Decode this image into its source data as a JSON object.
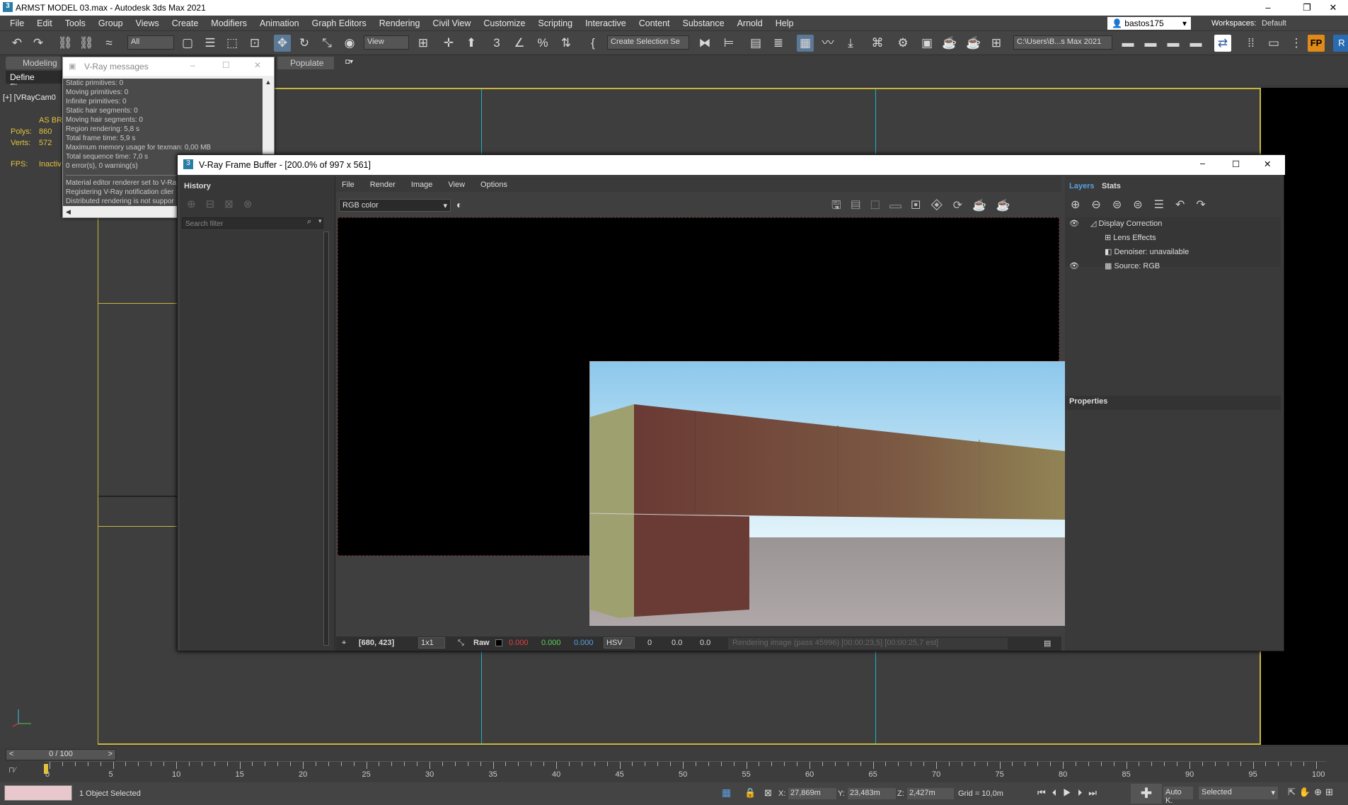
{
  "app": {
    "title": "ARMST MODEL 03.max - Autodesk 3ds Max 2021",
    "icon": "3"
  },
  "window_controls": {
    "minimize": "–",
    "restore": "❐",
    "close": "✕"
  },
  "menu": [
    "File",
    "Edit",
    "Tools",
    "Group",
    "Views",
    "Create",
    "Modifiers",
    "Animation",
    "Graph Editors",
    "Rendering",
    "Civil View",
    "Customize",
    "Scripting",
    "Interactive",
    "Content",
    "Substance",
    "Arnold",
    "Help"
  ],
  "user": {
    "name": "bastos175",
    "workspaces_label": "Workspaces:",
    "workspace": "Default"
  },
  "toolbar": {
    "selection_filter": "All",
    "ref_coord": "View",
    "named_selection": "Create Selection Se",
    "project_path": "C:\\Users\\B...s Max 2021"
  },
  "ribbon": {
    "tab_modeling": "Modeling",
    "define_flows": "Define Flows",
    "populate": "Populate"
  },
  "viewport": {
    "label": "[+] [VRayCam0",
    "as": "AS BRI",
    "polys_label": "Polys:",
    "polys": "860",
    "verts_label": "Verts:",
    "verts": "572",
    "fps_label": "FPS:",
    "fps": "Inactiv"
  },
  "vray_messages": {
    "title": "V-Ray messages",
    "lines": [
      "Static primitives: 0",
      "Moving primitives: 0",
      "Infinite primitives: 0",
      "Static hair segments: 0",
      "Moving hair segments: 0",
      "Region rendering: 5,8 s",
      "Total frame time: 5,9 s",
      "Maximum memory usage for texman: 0,00 MB",
      "Total sequence time: 7,0 s",
      "0 error(s), 0 warning(s)"
    ],
    "lines2": [
      "Material editor renderer set to V-Ra",
      "Registering V-Ray notification clier",
      "Distributed rendering is not suppor"
    ]
  },
  "vfb": {
    "title": "V-Ray Frame Buffer - [200.0% of 997 x 561]",
    "menu": [
      "File",
      "Render",
      "Image",
      "View",
      "Options"
    ],
    "history_label": "History",
    "search_placeholder": "Search filter",
    "channel": "RGB color",
    "layers_tab": "Layers",
    "stats_tab": "Stats",
    "layers": [
      "Display Correction",
      "Lens Effects",
      "Denoiser: unavailable",
      "Source: RGB"
    ],
    "properties_label": "Properties",
    "status": {
      "coords": "[680, 423]",
      "ratio": "1x1",
      "raw": "Raw",
      "r": "0.000",
      "g": "0.000",
      "b": "0.000",
      "mode": "HSV",
      "h": "0",
      "s": "0.0",
      "v": "0.0",
      "progress": "Rendering image (pass 45996) [00:00:23,5] [00:00:25,7 est]"
    }
  },
  "timeline": {
    "frame": "0 / 100",
    "ticks": [
      0,
      5,
      10,
      15,
      20,
      25,
      30,
      35,
      40,
      45,
      50,
      55,
      60,
      65,
      70,
      75,
      80,
      85,
      90,
      95,
      100
    ]
  },
  "status": {
    "selection": "1 Object Selected",
    "x_label": "X:",
    "x": "27,869m",
    "y_label": "Y:",
    "y": "23,483m",
    "z_label": "Z:",
    "z": "2,427m",
    "grid": "Grid = 10,0m",
    "autokey": "Auto K.",
    "selected": "Selected"
  },
  "colors": {
    "accent": "#5b7896",
    "viewport_border": "#c9b53e",
    "camera_line": "#18b3c0",
    "layers_tab": "#5aa0e0",
    "r": "#e04040",
    "g": "#5cd05c",
    "b": "#5aa0e0"
  }
}
